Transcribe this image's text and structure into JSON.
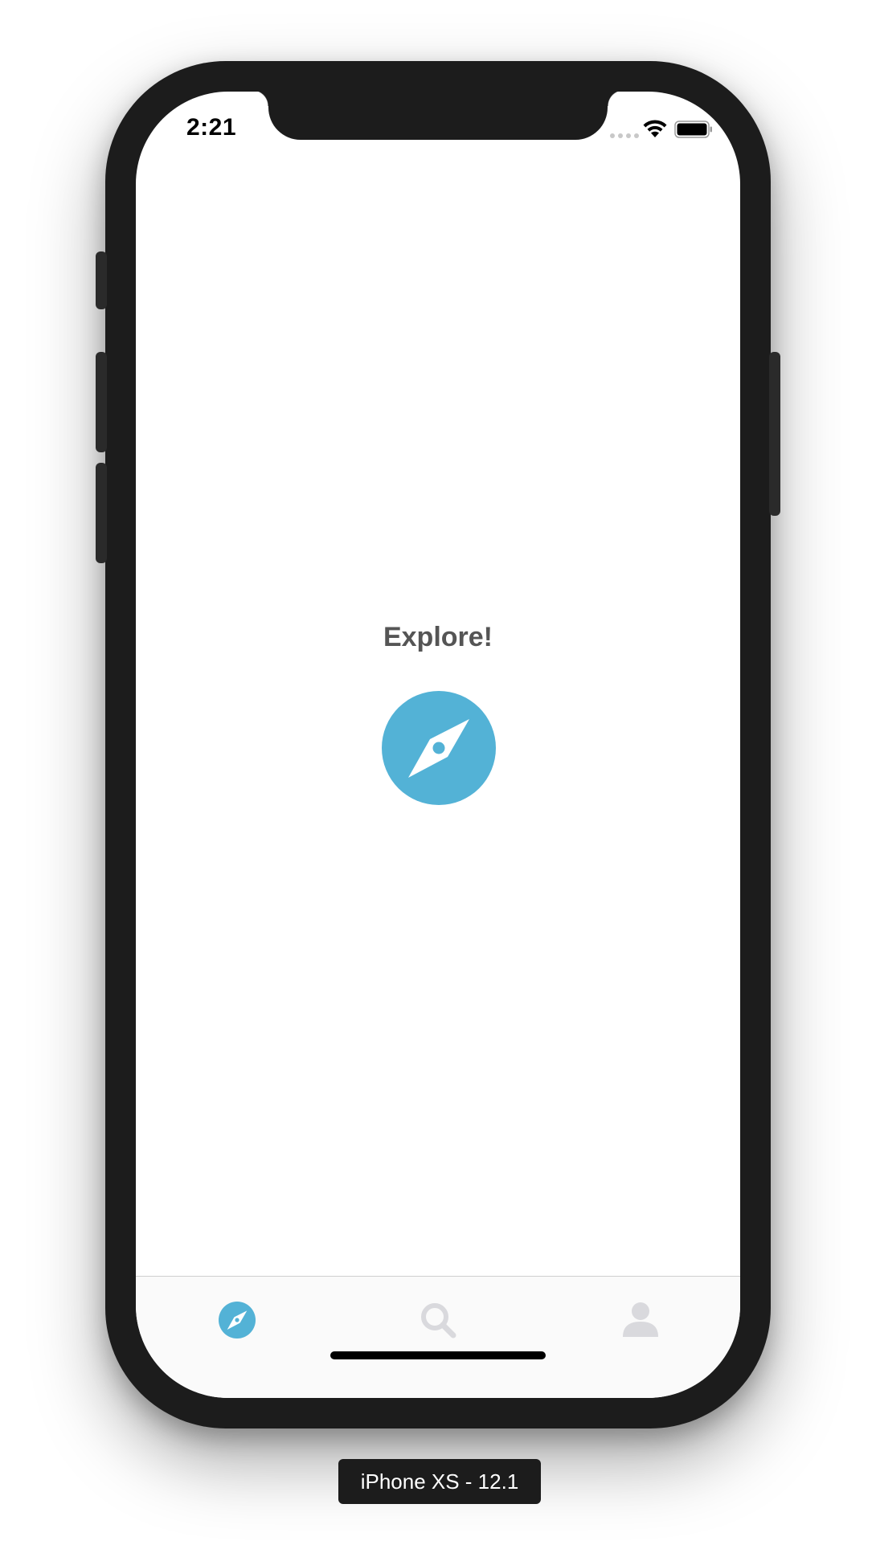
{
  "status_bar": {
    "time": "2:21"
  },
  "main": {
    "title": "Explore!",
    "badge_icon": "compass-icon",
    "accent_color": "#53b2d6"
  },
  "tab_bar": {
    "tabs": [
      {
        "icon": "compass-icon",
        "active": true
      },
      {
        "icon": "search-icon",
        "active": false
      },
      {
        "icon": "user-icon",
        "active": false
      }
    ],
    "active_color": "#53b2d6",
    "inactive_color": "#d9d9dd"
  },
  "simulator": {
    "device_label": "iPhone XS - 12.1"
  }
}
